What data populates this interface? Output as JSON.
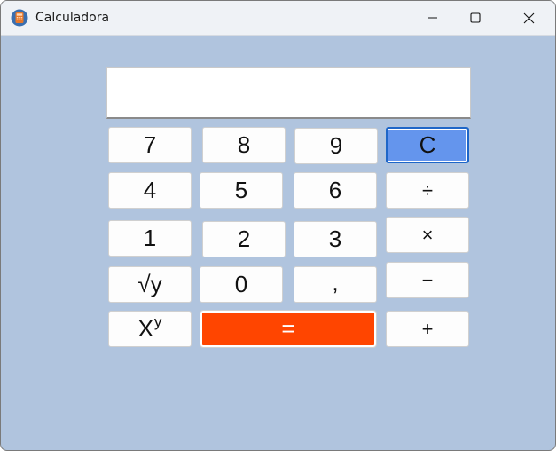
{
  "window": {
    "title": "Calculadora"
  },
  "display": {
    "value": ""
  },
  "keys": {
    "k7": "7",
    "k8": "8",
    "k9": "9",
    "clear": "C",
    "k4": "4",
    "k5": "5",
    "k6": "6",
    "divide": "÷",
    "k1": "1",
    "k2": "2",
    "k3": "3",
    "multiply": "×",
    "sqrt": "√y",
    "k0": "0",
    "comma": ",",
    "minus": "−",
    "power_base": "X",
    "power_exp": "y",
    "equals": "=",
    "plus": "+"
  },
  "colors": {
    "background": "#b0c4de",
    "clear_key": "#6495ed",
    "equals_key": "#ff4500"
  },
  "icons": {
    "app": "calculator-icon",
    "minimize": "minimize-icon",
    "maximize": "maximize-icon",
    "close": "close-icon"
  }
}
